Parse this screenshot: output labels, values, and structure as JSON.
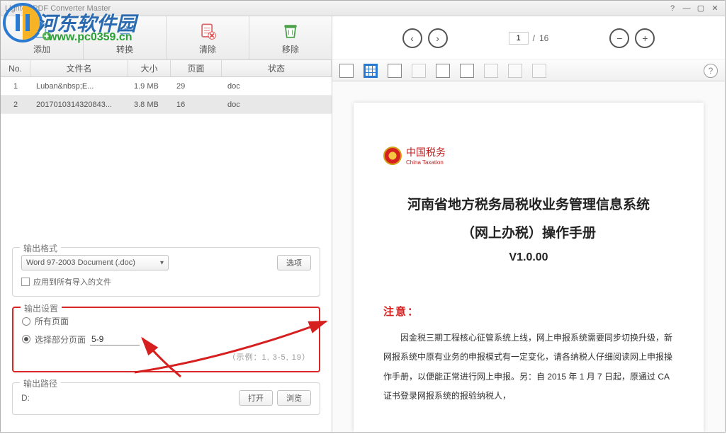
{
  "title": "Lighten PDF Converter Master",
  "toolbar": {
    "add": "添加",
    "convert": "转换",
    "clear": "清除",
    "remove": "移除"
  },
  "columns": {
    "no": "No.",
    "name": "文件名",
    "size": "大小",
    "page": "页面",
    "status": "状态"
  },
  "rows": [
    {
      "no": "1",
      "name": "Luban&amp;nbsp;E...",
      "size": "1.9 MB",
      "page": "29",
      "status": "doc"
    },
    {
      "no": "2",
      "name": "2017010314320843...",
      "size": "3.8 MB",
      "page": "16",
      "status": "doc"
    }
  ],
  "format": {
    "legend": "输出格式",
    "selected": "Word 97-2003 Document (.doc)",
    "options_btn": "选项",
    "apply_all": "应用到所有导入的文件"
  },
  "output": {
    "legend": "输出设置",
    "all_pages": "所有页面",
    "select_pages": "选择部分页面",
    "range_value": "5-9",
    "example": "（示例：1, 3-5, 19）"
  },
  "path": {
    "legend": "输出路径",
    "value": "D:",
    "open": "打开",
    "browse": "浏览"
  },
  "nav": {
    "current": "1",
    "sep": "/",
    "total": "16"
  },
  "doc": {
    "logo_cn": "中国税务",
    "logo_en": "China Taxation",
    "title_l1": "河南省地方税务局税收业务管理信息系统",
    "title_l2": "（网上办税）操作手册",
    "version": "V1.0.00",
    "notice_label": "注意：",
    "body": "因金税三期工程核心征管系统上线，网上申报系统需要同步切换升级，新网报系统中原有业务的申报模式有一定变化，请各纳税人仔细阅读网上申报操作手册，以便能正常进行网上申报。另：自 2015 年 1 月 7 日起，原通过 CA 证书登录网报系统的报验纳税人，"
  },
  "watermark": {
    "text": "河东软件园",
    "url": "www.pc0359.cn"
  }
}
